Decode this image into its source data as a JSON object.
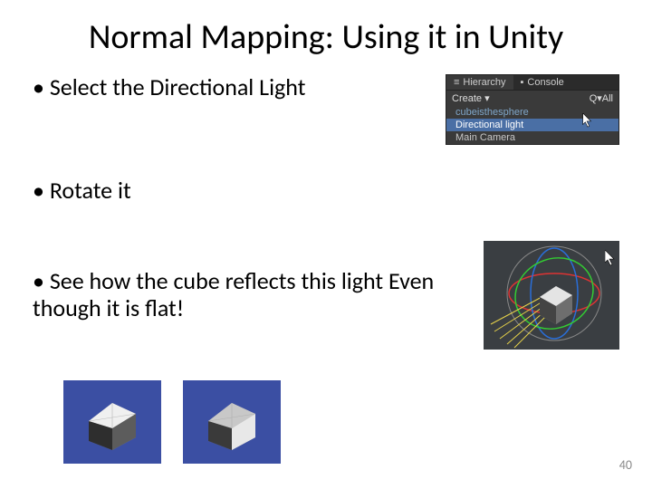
{
  "title": "Normal Mapping: Using it in Unity",
  "bullets": {
    "b1": "Select the Directional Light",
    "b2": "Rotate it",
    "b3": "See how the cube reflects this light Even though it is flat!"
  },
  "hierarchy": {
    "tab_hierarchy": "Hierarchy",
    "tab_console": "Console",
    "create_label": "Create",
    "search_label": "Q▾All",
    "item_cube": "cubeisthesphere",
    "item_light": "Directional light",
    "item_camera": "Main Camera"
  },
  "page_number": "40"
}
